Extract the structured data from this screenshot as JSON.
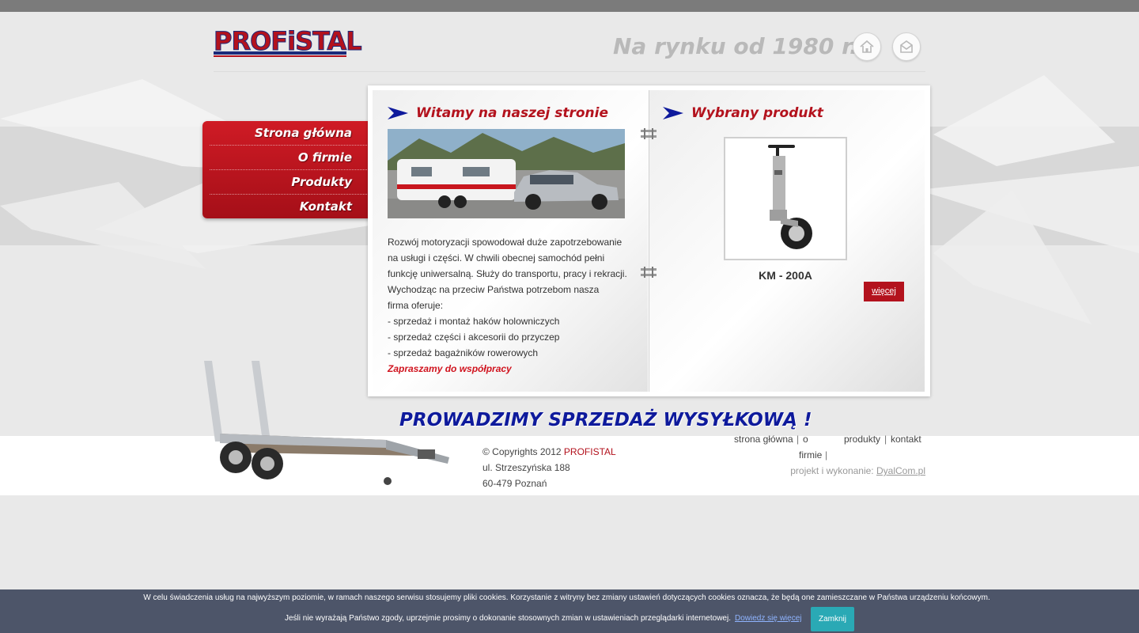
{
  "header": {
    "logo_text": "PROFiSTAL",
    "slogan": "Na rynku od 1980 r."
  },
  "icons": {
    "home": "home-icon",
    "mail": "mail-icon"
  },
  "nav": {
    "items": [
      {
        "label": "Strona główna"
      },
      {
        "label": "O firmie"
      },
      {
        "label": "Produkty"
      },
      {
        "label": "Kontakt"
      }
    ]
  },
  "welcome": {
    "title": "Witamy na naszej stronie",
    "paragraph_lines": [
      "Rozwój motoryzacji spowodował duże zapotrzebowanie",
      "na usługi i części. W chwili obecnej samochód pełni",
      "funkcję uniwersalną. Służy do transportu, pracy i rekracji.",
      "Wychodząc na przeciw Państwa potrzebom nasza",
      "firma oferuje:",
      "- sprzedaż i montaż haków holowniczych",
      "- sprzedaż części i akcesorii do przyczep",
      "- sprzedaż bagażników rowerowych"
    ],
    "cta": "Zapraszamy do współpracy"
  },
  "product": {
    "title": "Wybrany produkt",
    "name": "KM - 200A",
    "more_label": "więcej"
  },
  "banner": {
    "text": "PROWADZIMY SPRZEDAŻ WYSYŁKOWĄ !"
  },
  "footer": {
    "copyright_prefix": "© Copyrights 2012 ",
    "brand": "PROFISTAL",
    "street": "ul. Strzeszyńska 188",
    "city": "60-479 Poznań",
    "links": {
      "home": "strona główna",
      "about_1": "o",
      "about_2": "firmie",
      "products": "produkty",
      "contact": "kontakt",
      "separator": "|"
    },
    "credits_prefix": "projekt i wykonanie: ",
    "credits_link": "DyalCom.pl"
  },
  "cookie": {
    "line1": "W celu świadczenia usług na najwyższym poziomie, w ramach naszego serwisu stosujemy pliki cookies. Korzystanie z witryny bez zmiany ustawień dotyczących cookies oznacza, że będą one zamieszczane w Państwa urządzeniu końcowym.",
    "line2": "Jeśli nie wyrażają Państwo zgody, uprzejmie prosimy o dokonanie stosownych zmian w ustawieniach przeglądarki internetowej.",
    "more_label": "Dowiedz się więcej",
    "close_label": "Zamknij"
  }
}
